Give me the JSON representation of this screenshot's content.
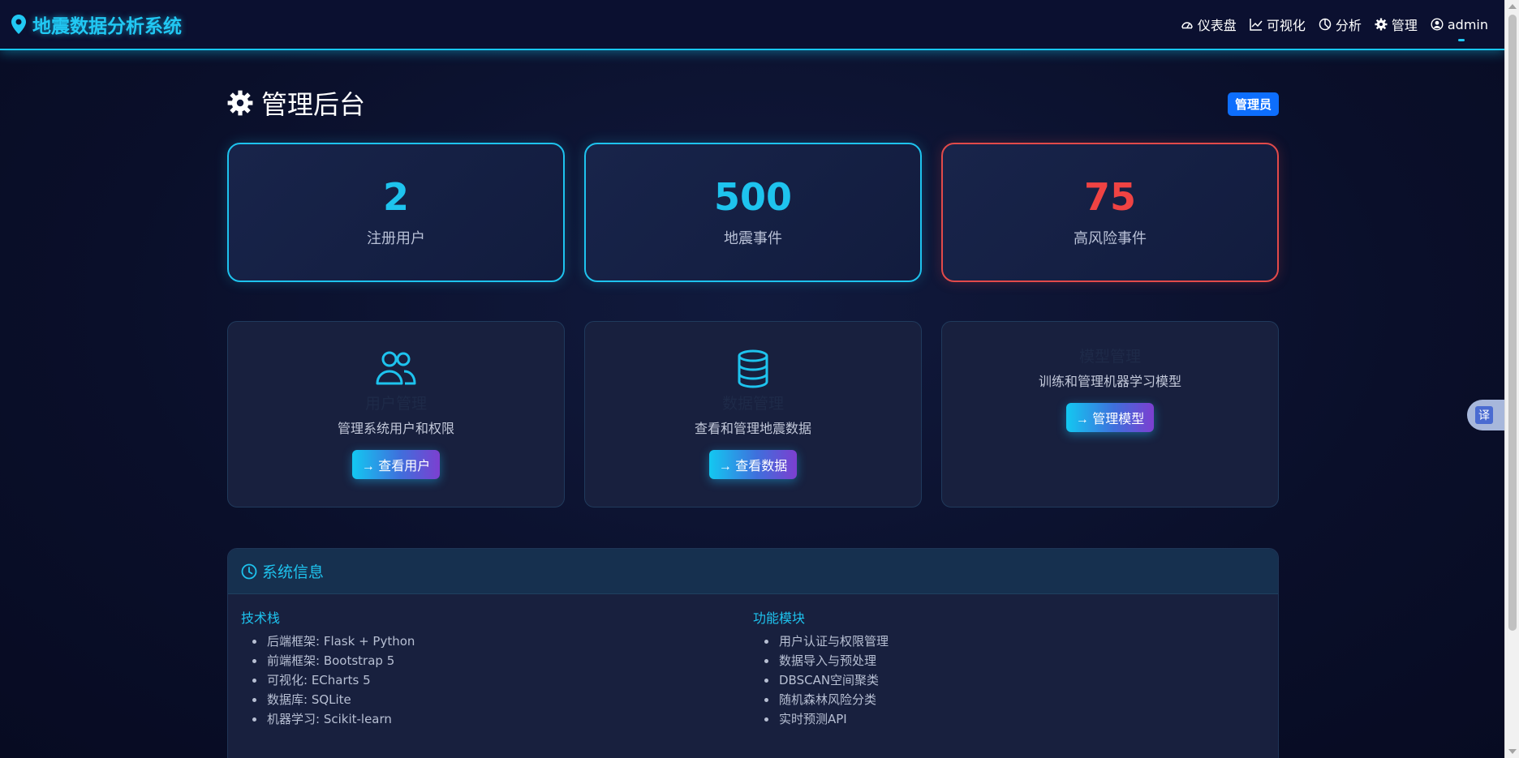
{
  "navbar": {
    "brand": "地震数据分析系统",
    "items": [
      {
        "label": "仪表盘",
        "icon": "speedometer-icon"
      },
      {
        "label": "可视化",
        "icon": "line-chart-icon"
      },
      {
        "label": "分析",
        "icon": "pie-chart-icon"
      },
      {
        "label": "管理",
        "icon": "gear-icon"
      },
      {
        "label": "admin",
        "icon": "user-circle-icon"
      }
    ]
  },
  "page": {
    "title": "管理后台",
    "badge": "管理员"
  },
  "stats": [
    {
      "value": "2",
      "label": "注册用户",
      "color": "#1ec3ee"
    },
    {
      "value": "500",
      "label": "地震事件",
      "color": "#1ec3ee"
    },
    {
      "value": "75",
      "label": "高风险事件",
      "color": "#ef4343"
    }
  ],
  "modules": [
    {
      "title": "用户管理",
      "desc": "管理系统用户和权限",
      "button": "→ 查看用户",
      "icon": "users-icon"
    },
    {
      "title": "数据管理",
      "desc": "查看和管理地震数据",
      "button": "→ 查看数据",
      "icon": "database-icon"
    },
    {
      "title": "模型管理",
      "desc": "训练和管理机器学习模型",
      "button": "→ 管理模型",
      "icon": ""
    }
  ],
  "sysinfo": {
    "title": "系统信息",
    "tech": {
      "title": "技术栈",
      "items": [
        "后端框架: Flask + Python",
        "前端框架: Bootstrap 5",
        "可视化: ECharts 5",
        "数据库: SQLite",
        "机器学习: Scikit-learn"
      ]
    },
    "features": {
      "title": "功能模块",
      "items": [
        "用户认证与权限管理",
        "数据导入与预处理",
        "DBSCAN空间聚类",
        "随机森林风险分类",
        "实时预测API"
      ]
    }
  },
  "translate": {
    "label": "译"
  }
}
